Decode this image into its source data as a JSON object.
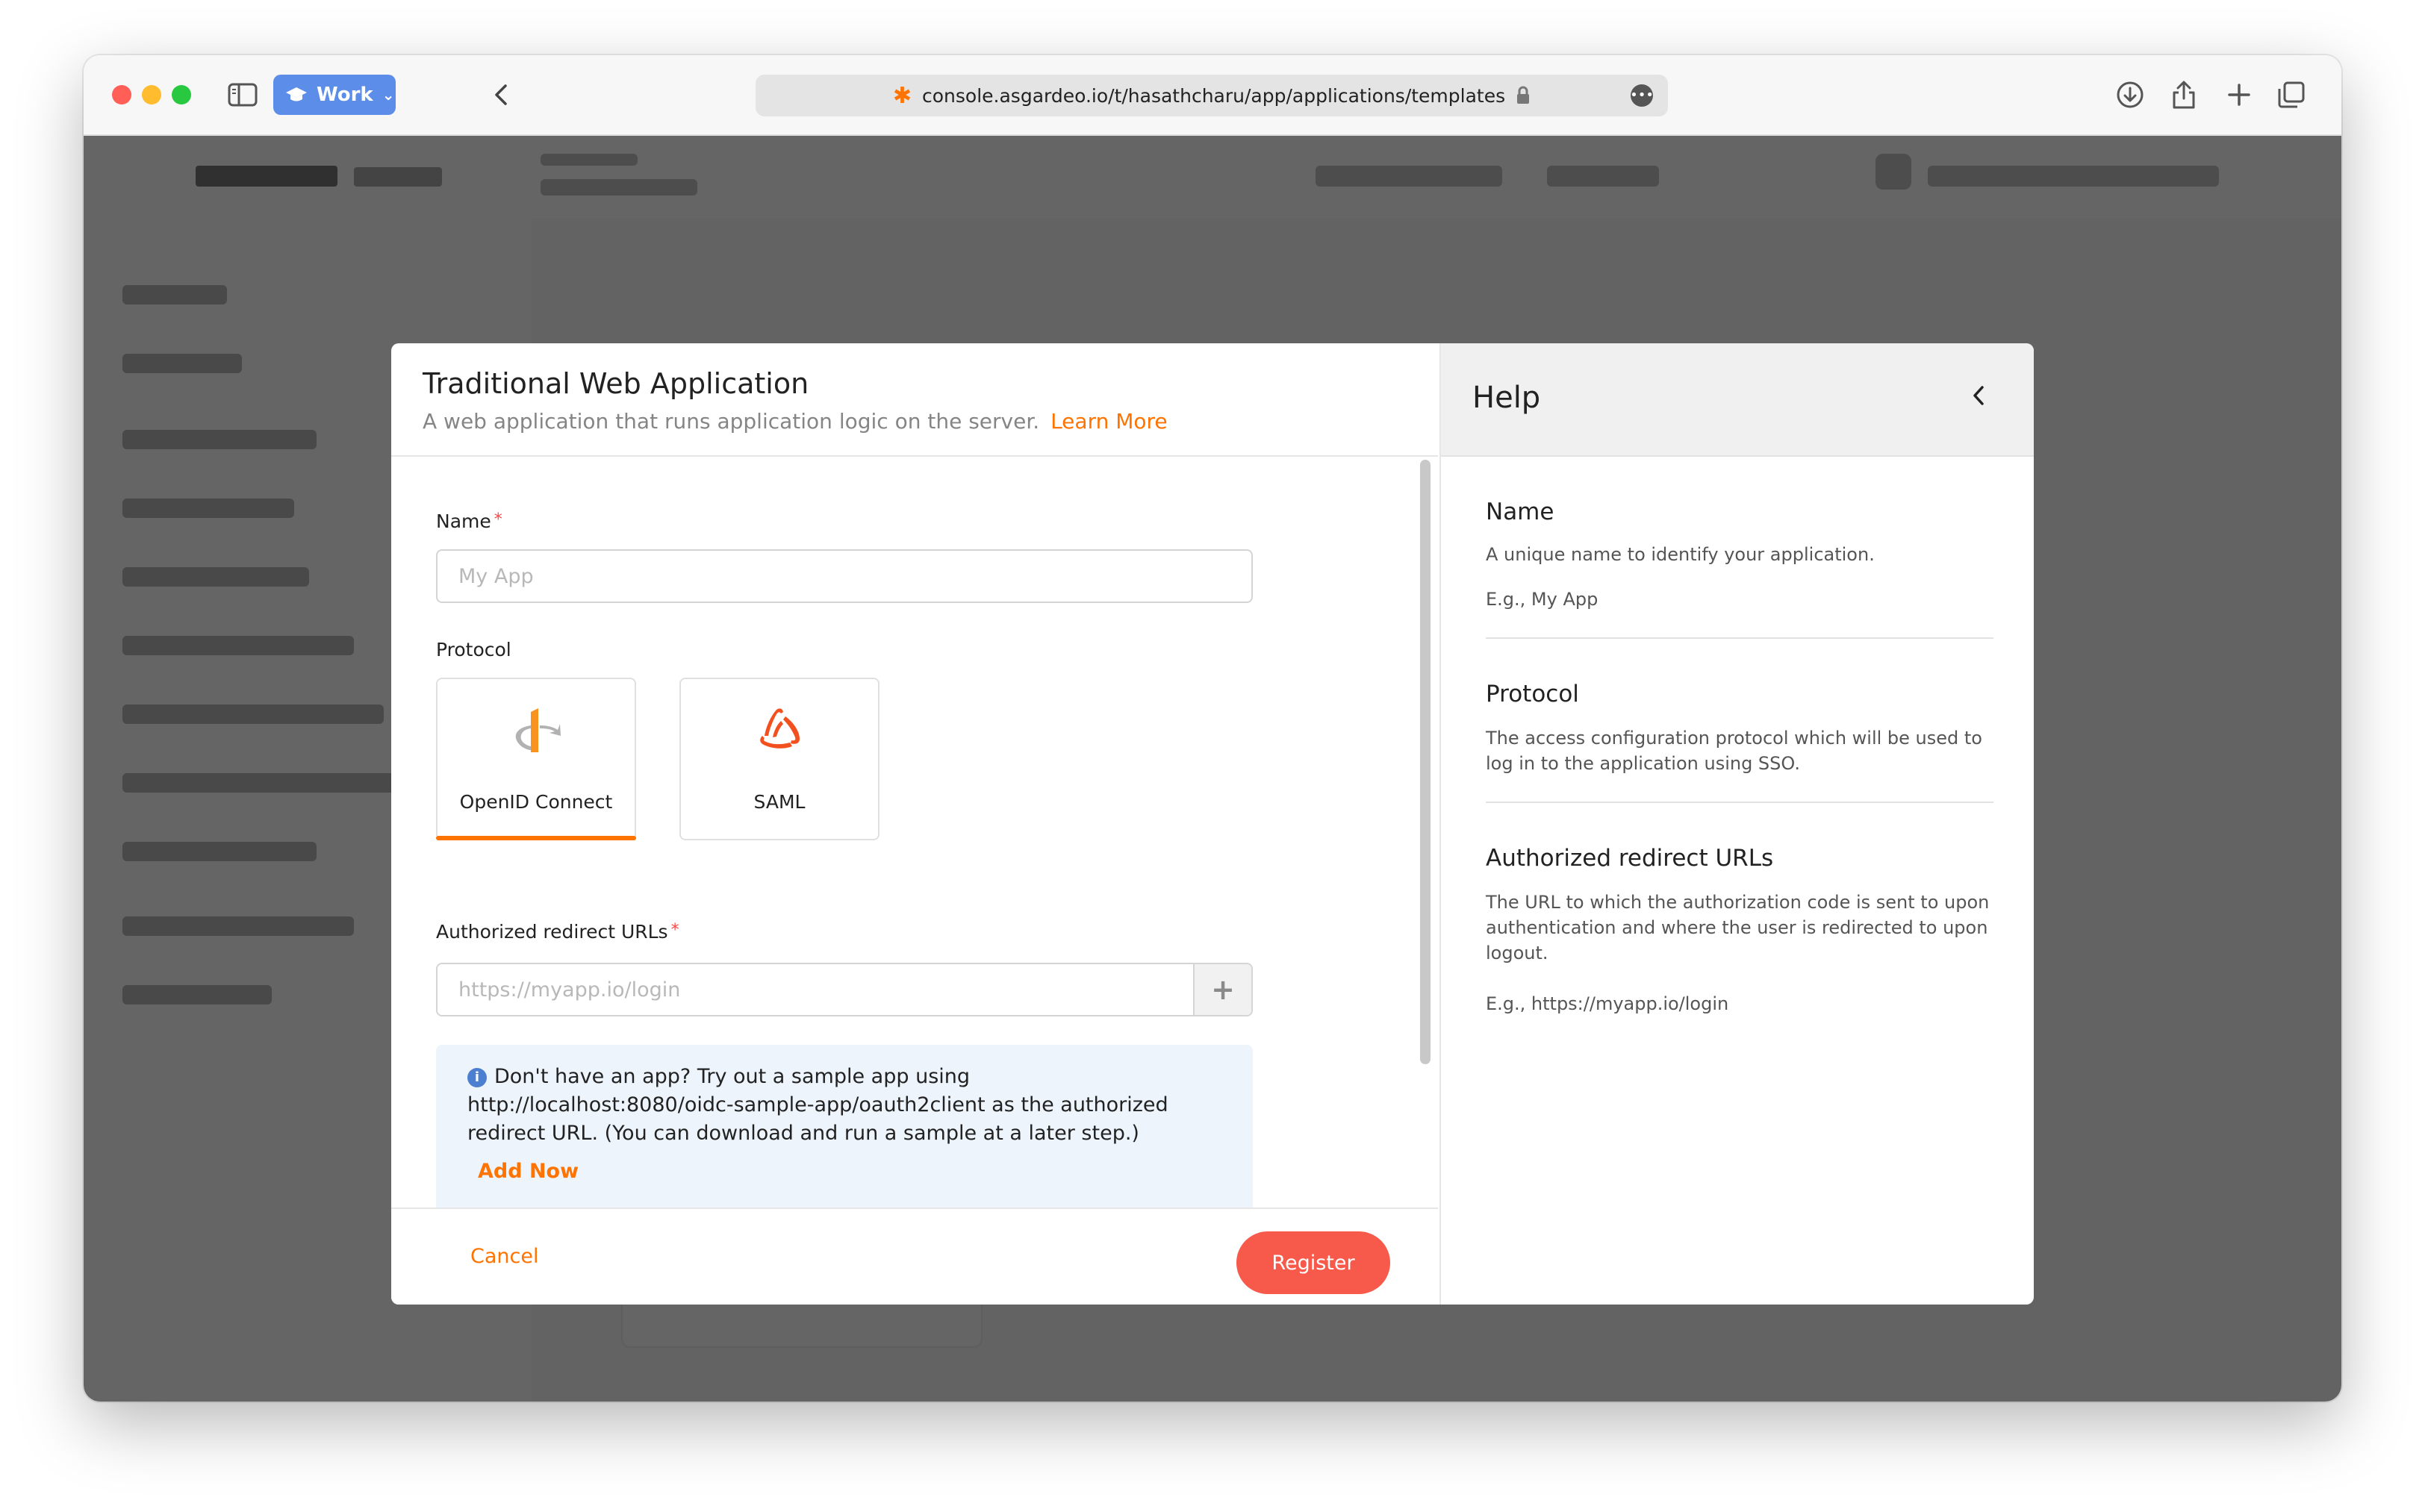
{
  "browser": {
    "profile_label": "Work",
    "url": "console.asgardeo.io/t/hasathcharu/app/applications/templates"
  },
  "modal": {
    "title": "Traditional Web Application",
    "subtitle": "A web application that runs application logic on the server.",
    "learn_more": "Learn More",
    "name_label": "Name",
    "name_placeholder": "My App",
    "protocol_label": "Protocol",
    "protocols": [
      {
        "label": "OpenID Connect",
        "selected": true
      },
      {
        "label": "SAML",
        "selected": false
      }
    ],
    "redirect_label": "Authorized redirect URLs",
    "redirect_placeholder": "https://myapp.io/login",
    "required_marker": "*",
    "info_text": "Don't have an app? Try out a sample app using http://localhost:8080/oidc-sample-app/oauth2client as the authorized redirect URL. (You can download and run a sample at a later step.)",
    "add_now": "Add Now",
    "cancel": "Cancel",
    "register": "Register"
  },
  "help": {
    "title": "Help",
    "sections": [
      {
        "title": "Name",
        "text": "A unique name to identify your application.",
        "example": "E.g., My App"
      },
      {
        "title": "Protocol",
        "text": "The access configuration protocol which will be used to log in to the application using SSO."
      },
      {
        "title": "Authorized redirect URLs",
        "text": "The URL to which the authorization code is sent to upon authentication and where the user is redirected to upon logout.",
        "example": "E.g., https://myapp.io/login"
      }
    ]
  },
  "colors": {
    "accent": "#ff7300",
    "register_button": "#f7594a",
    "info_background": "#edf4fc",
    "info_icon": "#4d7fd1"
  }
}
